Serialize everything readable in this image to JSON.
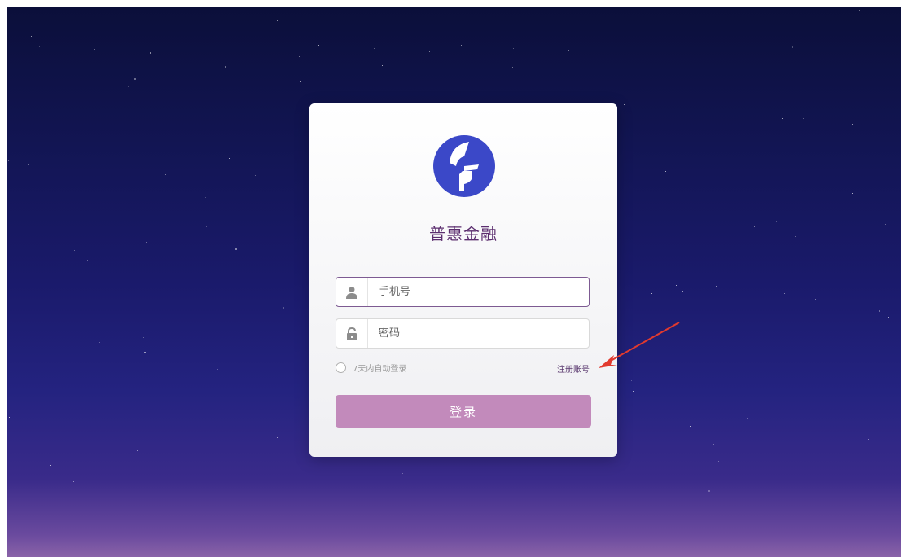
{
  "brand": {
    "name": "普惠金融",
    "logo_icon": "brand-logo-icon",
    "logo_color": "#3b48c8"
  },
  "form": {
    "phone": {
      "placeholder": "手机号",
      "value": "",
      "icon": "user-icon"
    },
    "password": {
      "placeholder": "密码",
      "value": "",
      "icon": "lock-icon"
    },
    "remember_label": "7天内自动登录",
    "register_link": "注册账号",
    "login_button": "登录"
  },
  "annotation": {
    "arrow_color": "#e23a2e",
    "points_to": "register-link"
  },
  "colors": {
    "accent": "#c28abb",
    "title": "#5b2d6e",
    "active_border": "#7d5a92",
    "background_top": "#0b0f3a",
    "background_bottom": "#8a63a8"
  }
}
